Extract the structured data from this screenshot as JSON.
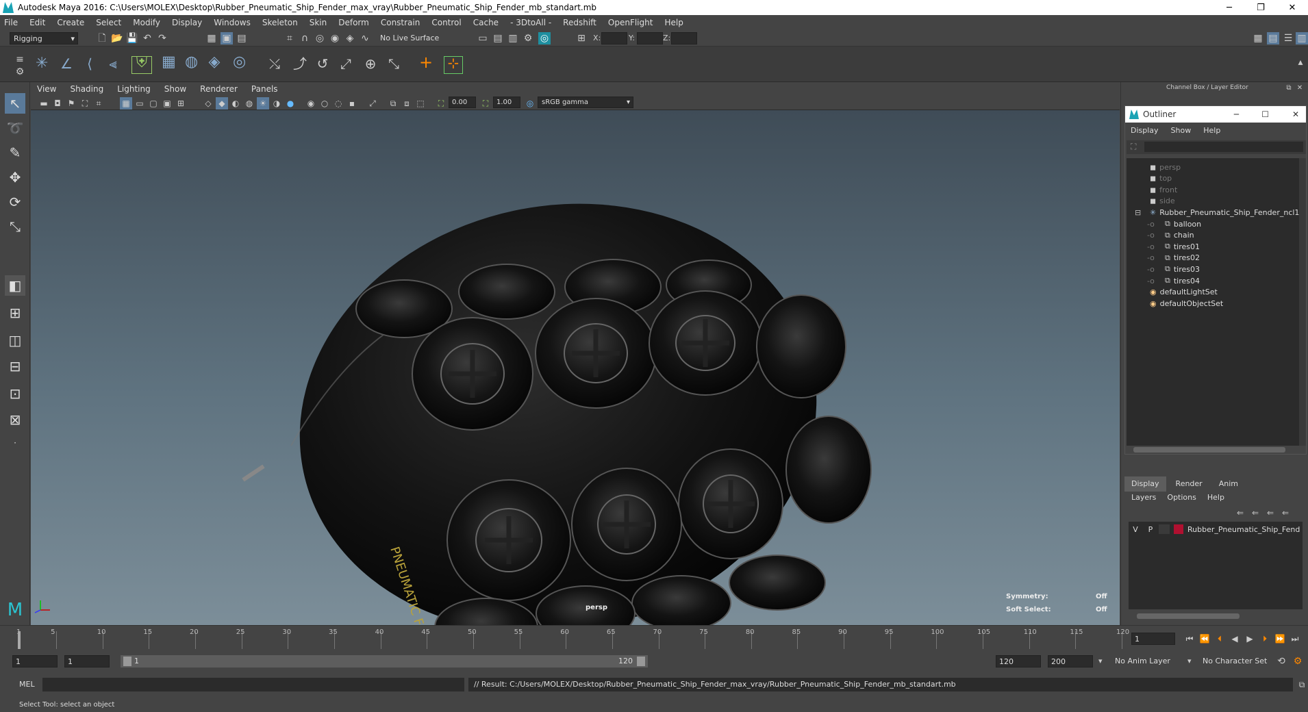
{
  "window": {
    "title": "Autodesk Maya 2016: C:\\Users\\MOLEX\\Desktop\\Rubber_Pneumatic_Ship_Fender_max_vray\\Rubber_Pneumatic_Ship_Fender_mb_standart.mb",
    "minimize": "─",
    "restore": "❐",
    "close": "✕"
  },
  "menubar": [
    "File",
    "Edit",
    "Create",
    "Select",
    "Modify",
    "Display",
    "Windows",
    "Skeleton",
    "Skin",
    "Deform",
    "Constrain",
    "Control",
    "Cache",
    "- 3DtoAll -",
    "Redshift",
    "OpenFlight",
    "Help"
  ],
  "shelf": {
    "mode": "Rigging",
    "live_surface": "No Live Surface",
    "x_label": "X:",
    "y_label": "Y:",
    "z_label": "Z:"
  },
  "viewport_menu": [
    "View",
    "Shading",
    "Lighting",
    "Show",
    "Renderer",
    "Panels"
  ],
  "viewport_toolbar": {
    "value1": "0.00",
    "value2": "1.00",
    "color_space": "sRGB gamma"
  },
  "viewport": {
    "camera": "persp",
    "symmetry_label": "Symmetry:",
    "symmetry_value": "Off",
    "soft_select_label": "Soft Select:",
    "soft_select_value": "Off",
    "fender_text": "PNEUMATIC FENDER"
  },
  "channel_box_title": "Channel Box / Layer Editor",
  "outliner": {
    "title": "Outliner",
    "menus": [
      "Display",
      "Show",
      "Help"
    ],
    "items": [
      {
        "label": "persp",
        "type": "camera",
        "depth": 0,
        "dim": true
      },
      {
        "label": "top",
        "type": "camera",
        "depth": 0,
        "dim": true
      },
      {
        "label": "front",
        "type": "camera",
        "depth": 0,
        "dim": true
      },
      {
        "label": "side",
        "type": "camera",
        "depth": 0,
        "dim": true
      },
      {
        "label": "Rubber_Pneumatic_Ship_Fender_ncl1",
        "type": "group",
        "depth": 0,
        "dim": false
      },
      {
        "label": "balloon",
        "type": "mesh",
        "depth": 1,
        "dim": false
      },
      {
        "label": "chain",
        "type": "mesh",
        "depth": 1,
        "dim": false
      },
      {
        "label": "tires01",
        "type": "mesh",
        "depth": 1,
        "dim": false
      },
      {
        "label": "tires02",
        "type": "mesh",
        "depth": 1,
        "dim": false
      },
      {
        "label": "tires03",
        "type": "mesh",
        "depth": 1,
        "dim": false
      },
      {
        "label": "tires04",
        "type": "mesh",
        "depth": 1,
        "dim": false
      },
      {
        "label": "defaultLightSet",
        "type": "set",
        "depth": 0,
        "dim": false
      },
      {
        "label": "defaultObjectSet",
        "type": "set",
        "depth": 0,
        "dim": false
      }
    ]
  },
  "layer_editor": {
    "tabs": [
      "Display",
      "Render",
      "Anim"
    ],
    "menus": [
      "Layers",
      "Options",
      "Help"
    ],
    "layer": {
      "v": "V",
      "p": "P",
      "name": "Rubber_Pneumatic_Ship_Fend",
      "color": "#b01030"
    }
  },
  "timeline": {
    "ticks": [
      "1",
      "5",
      "10",
      "15",
      "20",
      "25",
      "30",
      "35",
      "40",
      "45",
      "50",
      "55",
      "60",
      "65",
      "70",
      "75",
      "80",
      "85",
      "90",
      "95",
      "100",
      "105",
      "110",
      "115",
      "120"
    ],
    "current_frame": "1"
  },
  "range": {
    "start": "1",
    "start2": "1",
    "slider_start": "1",
    "slider_end": "120",
    "end": "120",
    "end2": "200",
    "anim_layer": "No Anim Layer",
    "char_set": "No Character Set"
  },
  "command": {
    "lang": "MEL",
    "result": "// Result: C:/Users/MOLEX/Desktop/Rubber_Pneumatic_Ship_Fender_max_vray/Rubber_Pneumatic_Ship_Fender_mb_standart.mb"
  },
  "help_line": "Select Tool: select an object"
}
